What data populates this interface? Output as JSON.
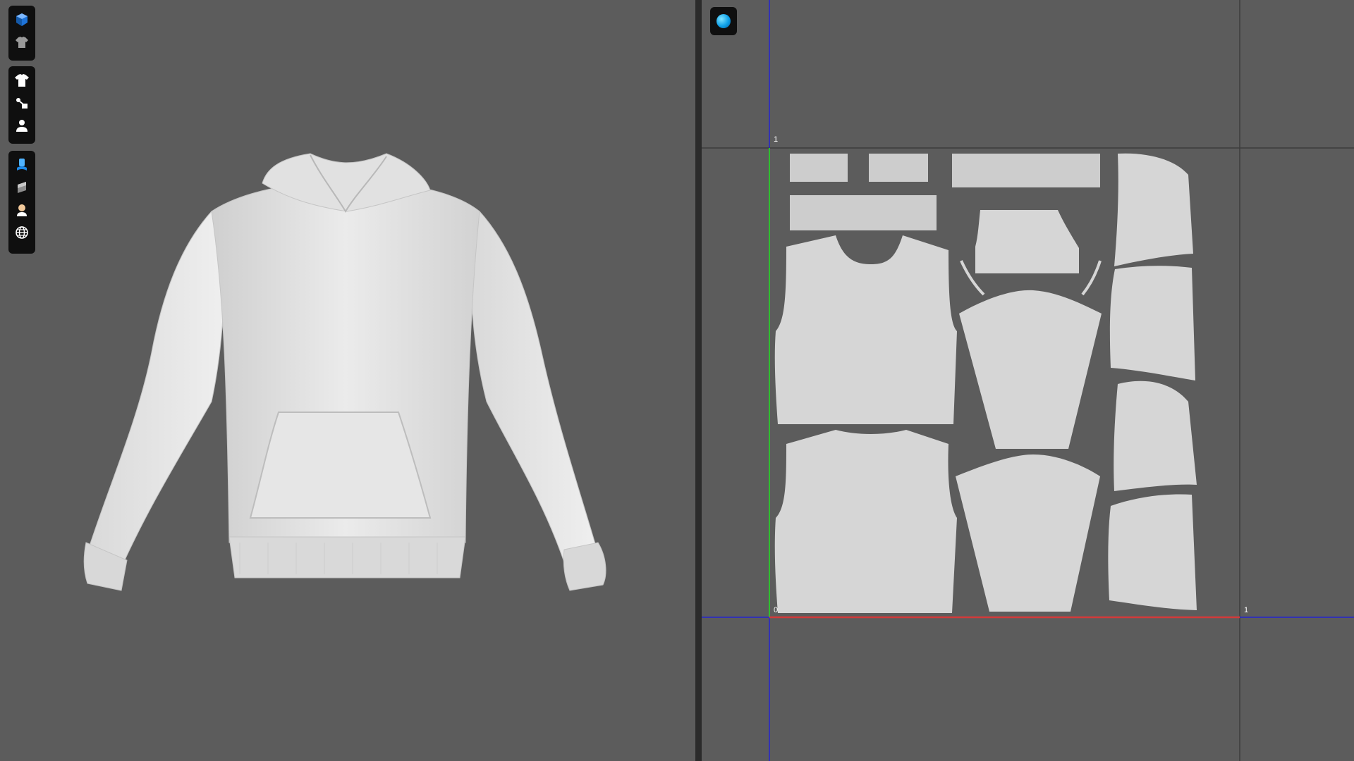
{
  "toolbar": {
    "groups": [
      {
        "buttons": [
          {
            "icon": "cube-view-icon"
          },
          {
            "icon": "avatar-garment-icon"
          }
        ]
      },
      {
        "buttons": [
          {
            "icon": "tshirt-icon"
          },
          {
            "icon": "sewing-tool-icon"
          },
          {
            "icon": "person-icon"
          }
        ]
      },
      {
        "buttons": [
          {
            "icon": "fabric-render-icon"
          },
          {
            "icon": "texture-icon"
          },
          {
            "icon": "skin-icon"
          },
          {
            "icon": "globe-icon"
          }
        ]
      }
    ]
  },
  "uv_editor": {
    "toggle_icon": "uv-sphere-icon",
    "axis_labels": {
      "v_max": "1",
      "origin": "0",
      "u_max": "1"
    },
    "axis_colors": {
      "u_axis": "#d23a3a",
      "v_axis": "#2fbf2f",
      "grid": "#2424d0"
    }
  },
  "garment": {
    "name": "hoodie",
    "color": "#e3e3e3"
  },
  "colors": {
    "background": "#5c5c5c",
    "toolbar": "#0f0f0f",
    "pattern_piece": "#d6d6d6",
    "pattern_band": "#cdcdcd"
  }
}
